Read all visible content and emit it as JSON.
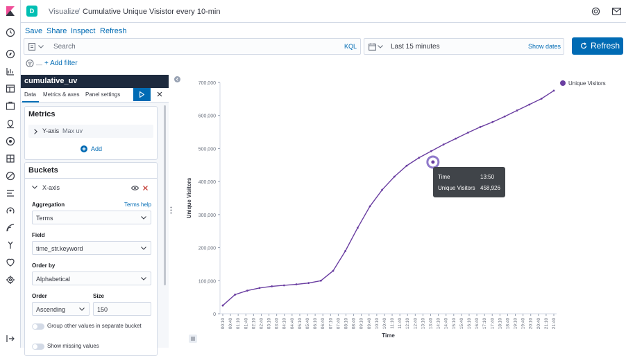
{
  "header": {
    "space_initial": "D",
    "breadcrumb_parent": "Visualize",
    "breadcrumb_sep": "/",
    "breadcrumb_current": "Cumulative Unique Visistor every 10-min"
  },
  "top_menu": {
    "save": "Save",
    "share": "Share",
    "inspect": "Inspect",
    "refresh": "Refresh"
  },
  "query": {
    "placeholder": "Search",
    "language": "KQL"
  },
  "time": {
    "range": "Last 15 minutes",
    "show_dates": "Show dates",
    "refresh_button": "Refresh"
  },
  "filters": {
    "add_filter": "+ Add filter"
  },
  "editor": {
    "vis_name": "cumulative_uv",
    "tabs": [
      "Data",
      "Metrics & axes",
      "Panel settings"
    ],
    "metrics_title": "Metrics",
    "yaxis_label": "Y-axis",
    "yaxis_value": "Max uv",
    "add_label": "Add",
    "buckets_title": "Buckets",
    "xaxis_label": "X-axis",
    "aggregation_label": "Aggregation",
    "terms_help": "Terms help",
    "aggregation_value": "Terms",
    "field_label": "Field",
    "field_value": "time_str.keyword",
    "order_by_label": "Order by",
    "order_by_value": "Alphabetical",
    "order_label": "Order",
    "order_value": "Ascending",
    "size_label": "Size",
    "size_value": "150",
    "group_other": "Group other values in separate bucket",
    "show_missing": "Show missing values"
  },
  "tooltip": {
    "time_label": "Time",
    "time_value": "13:50",
    "metric_label": "Unique Visitors",
    "metric_value": "458,926"
  },
  "chart_data": {
    "type": "line",
    "xlabel": "Time",
    "ylabel": "Unique Visitors",
    "ylim": [
      0,
      700000
    ],
    "yticks": [
      "0",
      "100,000",
      "200,000",
      "300,000",
      "400,000",
      "500,000",
      "600,000",
      "700,000"
    ],
    "x": [
      "00:10",
      "00:40",
      "01:10",
      "01:40",
      "02:10",
      "02:40",
      "03:10",
      "03:40",
      "04:10",
      "04:40",
      "05:10",
      "05:40",
      "06:10",
      "06:40",
      "07:10",
      "07:40",
      "08:10",
      "08:40",
      "09:10",
      "09:40",
      "10:10",
      "10:40",
      "11:10",
      "11:40",
      "12:10",
      "12:40",
      "13:10",
      "13:40",
      "14:10",
      "14:40",
      "15:10",
      "15:40",
      "16:10",
      "16:40",
      "17:10",
      "17:40",
      "18:10",
      "18:40",
      "19:10",
      "19:40",
      "20:10",
      "20:40",
      "21:10",
      "21:40"
    ],
    "series": [
      {
        "name": "Unique Visitors",
        "color": "#6a3ea1",
        "values": [
          25000,
          58000,
          70000,
          78000,
          83000,
          86000,
          89000,
          93000,
          100000,
          130000,
          190000,
          260000,
          325000,
          375000,
          415000,
          448000,
          472000,
          492000,
          512000,
          530000,
          548000,
          565000,
          580000,
          597000,
          615000,
          633000,
          651000,
          675000
        ]
      }
    ],
    "legend": "top-right",
    "highlight": {
      "x": "13:50",
      "y": 458926
    }
  }
}
